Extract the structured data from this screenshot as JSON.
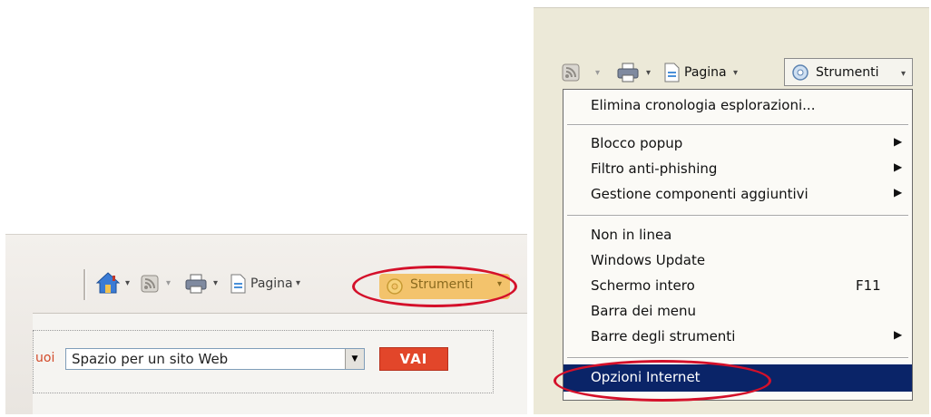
{
  "left_toolbar": {
    "page_label": "Pagina",
    "tools_label": "Strumenti",
    "dropdown_glyph": "▾"
  },
  "left_search": {
    "label_fragment": "uoi",
    "select_value": "Spazio per un sito Web",
    "go_button": "VAI"
  },
  "right_toolbar": {
    "page_label": "Pagina",
    "tools_label": "Strumenti"
  },
  "tools_menu": {
    "items": [
      {
        "label": "Elimina cronologia esplorazioni...",
        "shortcut": "",
        "submenu": false
      },
      {
        "label": "Blocco popup",
        "shortcut": "",
        "submenu": true
      },
      {
        "label": "Filtro anti-phishing",
        "shortcut": "",
        "submenu": true
      },
      {
        "label": "Gestione componenti aggiuntivi",
        "shortcut": "",
        "submenu": true
      },
      {
        "label": "Non in linea",
        "shortcut": "",
        "submenu": false
      },
      {
        "label": "Windows Update",
        "shortcut": "",
        "submenu": false
      },
      {
        "label": "Schermo intero",
        "shortcut": "F11",
        "submenu": false
      },
      {
        "label": "Barra dei menu",
        "shortcut": "",
        "submenu": false
      },
      {
        "label": "Barre degli strumenti",
        "shortcut": "",
        "submenu": true
      },
      {
        "label": "Opzioni Internet",
        "shortcut": "",
        "submenu": false
      }
    ],
    "submenu_arrow": "▶",
    "selected_item": "Opzioni Internet"
  },
  "icons": [
    "home-icon",
    "rss-feed-icon",
    "print-icon",
    "page-icon",
    "tools-gear-icon"
  ],
  "colors": {
    "highlight_ellipse": "#d4102a",
    "selected_item_bg": "#0a2468",
    "tools_hover": "#f3c36c",
    "go_button_bg": "#e2462a"
  }
}
